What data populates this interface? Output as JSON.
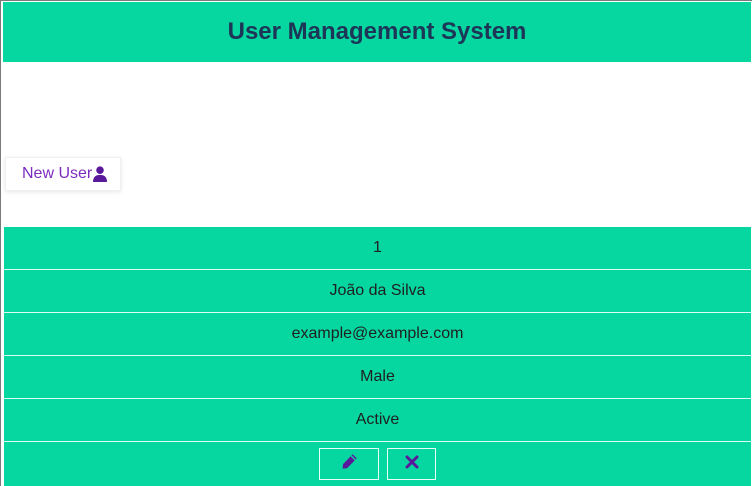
{
  "header": {
    "title": "User Management System"
  },
  "toolbar": {
    "new_user_label": "New User",
    "new_user_icon": "user-icon"
  },
  "user": {
    "id": "1",
    "name": "João da Silva",
    "email": "example@example.com",
    "gender": "Male",
    "status": "Active"
  },
  "actions": {
    "edit_icon": "pencil-icon",
    "delete_icon": "close-icon"
  },
  "colors": {
    "accent": "#06d6a0",
    "title": "#1d3557",
    "button_text": "#7b2cbf",
    "icon": "#5a189a",
    "page_background": "#ffffff"
  }
}
